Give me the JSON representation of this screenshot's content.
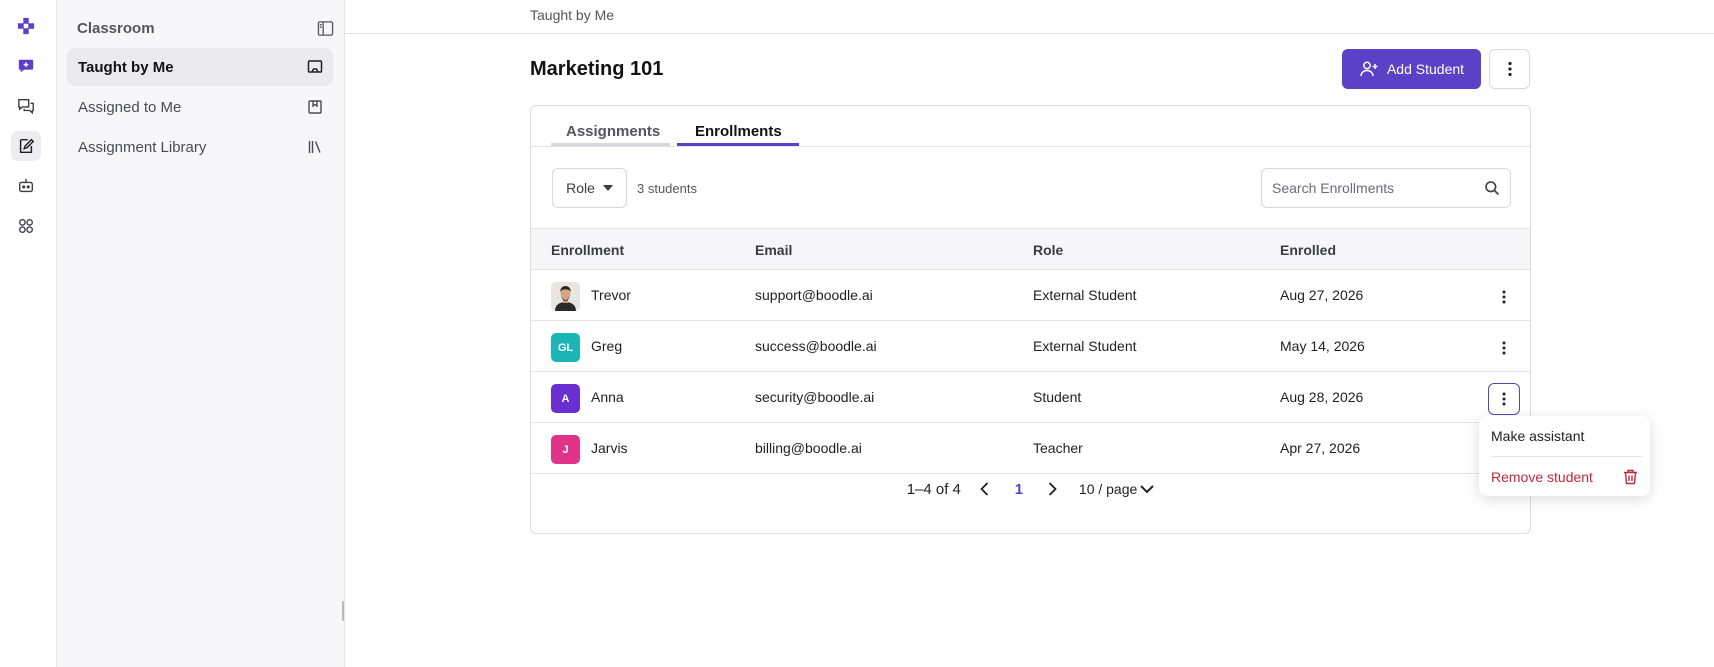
{
  "rail": {
    "items": [
      {
        "icon": "logo-icon"
      },
      {
        "icon": "new-chat-icon"
      },
      {
        "icon": "chats-icon"
      },
      {
        "icon": "classroom-icon"
      },
      {
        "icon": "bot-icon"
      },
      {
        "icon": "integrations-icon"
      }
    ]
  },
  "sidebar": {
    "title": "Classroom",
    "items": [
      {
        "label": "Taught by Me"
      },
      {
        "label": "Assigned to Me"
      },
      {
        "label": "Assignment Library"
      }
    ]
  },
  "breadcrumb": "Taught by Me",
  "page": {
    "title": "Marketing 101",
    "add_student_label": "Add Student"
  },
  "tabs": [
    {
      "label": "Assignments",
      "active": false
    },
    {
      "label": "Enrollments",
      "active": true
    }
  ],
  "filters": {
    "role_label": "Role",
    "count_text": "3 students",
    "search_placeholder": "Search Enrollments"
  },
  "table": {
    "columns": [
      "Enrollment",
      "Email",
      "Role",
      "Enrolled"
    ],
    "rows": [
      {
        "initials": "",
        "avatar_type": "photo",
        "avatar_color": "#3a3a3a",
        "name": "Trevor",
        "email": "support@boodle.ai",
        "role": "External Student",
        "enrolled": "Aug 27, 2026"
      },
      {
        "initials": "GL",
        "avatar_type": "initials",
        "avatar_color": "#1bb5b5",
        "name": "Greg",
        "email": "success@boodle.ai",
        "role": "External Student",
        "enrolled": "May 14, 2026"
      },
      {
        "initials": "A",
        "avatar_type": "initials",
        "avatar_color": "#6a2fd0",
        "name": "Anna",
        "email": "security@boodle.ai",
        "role": "Student",
        "enrolled": "Aug 28, 2026"
      },
      {
        "initials": "J",
        "avatar_type": "initials",
        "avatar_color": "#e0338a",
        "name": "Jarvis",
        "email": "billing@boodle.ai",
        "role": "Teacher",
        "enrolled": "Apr 27, 2026"
      }
    ]
  },
  "pagination": {
    "range": "1–4 of 4",
    "current_page": "1",
    "page_size": "10 / page"
  },
  "menu": {
    "items": [
      {
        "label": "Make assistant",
        "color": "#1f1f24"
      },
      {
        "label": "Remove student",
        "color": "#c0283a",
        "icon": "trash-icon"
      }
    ]
  },
  "colors": {
    "accent": "#5b40c8",
    "danger": "#c0283a"
  }
}
